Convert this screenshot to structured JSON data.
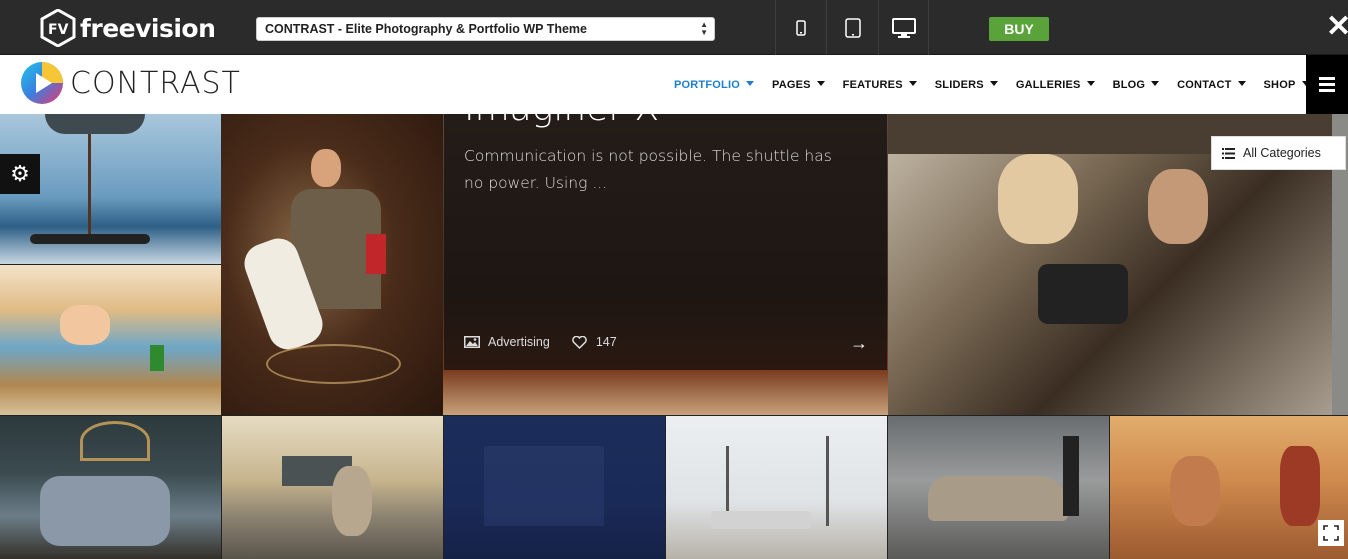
{
  "demo_bar": {
    "brand": "freevision",
    "theme_select_value": "CONTRAST - Elite Photography & Portfolio WP Theme",
    "buy_label": "BUY",
    "close_symbol": "✕",
    "devices": [
      "mobile-icon",
      "tablet-icon",
      "desktop-icon"
    ],
    "colors": {
      "bg": "#2b2b2b",
      "buy": "#5aa33a"
    }
  },
  "site": {
    "logo_text": "CONTRAST",
    "nav": [
      {
        "label": "PORTFOLIO",
        "active": true
      },
      {
        "label": "PAGES"
      },
      {
        "label": "FEATURES"
      },
      {
        "label": "SLIDERS"
      },
      {
        "label": "GALLERIES"
      },
      {
        "label": "BLOG"
      },
      {
        "label": "CONTACT"
      },
      {
        "label": "SHOP"
      }
    ],
    "accent_color": "#1e7fcf"
  },
  "portfolio": {
    "hover_item": {
      "title": "Imaginer X",
      "excerpt": "Communication is not possible. The shuttle has no power. Using ...",
      "category": "Advertising",
      "likes": "147"
    },
    "filter_label": "All Categories",
    "tiles": [
      "helicopter-rescue-photo",
      "beach-scene-photo",
      "library-couple-photo",
      "imaginer-x-photo",
      "car-binoculars-photo",
      "ornate-bed-photo",
      "street-creature-photo",
      "blue-toned-photo",
      "kid-plane-photo",
      "garage-car-photo",
      "warriors-photo"
    ]
  }
}
